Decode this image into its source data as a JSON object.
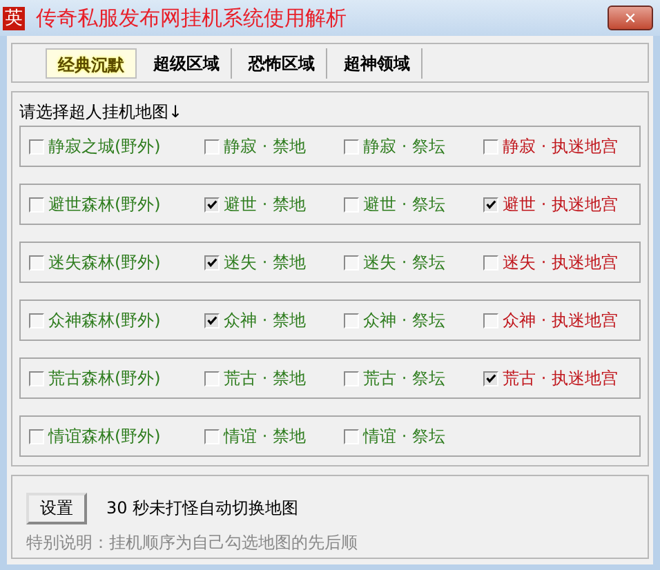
{
  "window": {
    "icon_text": "英",
    "title": "传奇私服发布网挂机系统使用解析",
    "close": "✕"
  },
  "tabs": [
    {
      "label": "经典沉默",
      "selected": true
    },
    {
      "label": "超级区域",
      "selected": false
    },
    {
      "label": "恐怖区域",
      "selected": false
    },
    {
      "label": "超神领域",
      "selected": false
    }
  ],
  "map_heading": "请选择超人挂机地图↓",
  "map_rows": [
    [
      {
        "label": "静寂之城(野外)",
        "checked": false,
        "color": "#2f7d1f"
      },
      {
        "label": "静寂 · 禁地",
        "checked": false,
        "color": "#2f7d1f"
      },
      {
        "label": "静寂 · 祭坛",
        "checked": false,
        "color": "#2f7d1f"
      },
      {
        "label": "静寂 · 执迷地宫",
        "checked": false,
        "color": "#c0161c"
      }
    ],
    [
      {
        "label": "避世森林(野外)",
        "checked": false,
        "color": "#2f7d1f"
      },
      {
        "label": "避世 · 禁地",
        "checked": true,
        "color": "#2f7d1f"
      },
      {
        "label": "避世 · 祭坛",
        "checked": false,
        "color": "#2f7d1f"
      },
      {
        "label": "避世 · 执迷地宫",
        "checked": true,
        "color": "#c0161c"
      }
    ],
    [
      {
        "label": "迷失森林(野外)",
        "checked": false,
        "color": "#2f7d1f"
      },
      {
        "label": "迷失 · 禁地",
        "checked": true,
        "color": "#2f7d1f"
      },
      {
        "label": "迷失 · 祭坛",
        "checked": false,
        "color": "#2f7d1f"
      },
      {
        "label": "迷失 · 执迷地宫",
        "checked": false,
        "color": "#c0161c"
      }
    ],
    [
      {
        "label": "众神森林(野外)",
        "checked": false,
        "color": "#2f7d1f"
      },
      {
        "label": "众神 · 禁地",
        "checked": true,
        "color": "#2f7d1f"
      },
      {
        "label": "众神 · 祭坛",
        "checked": false,
        "color": "#2f7d1f"
      },
      {
        "label": "众神 · 执迷地宫",
        "checked": false,
        "color": "#c0161c"
      }
    ],
    [
      {
        "label": "荒古森林(野外)",
        "checked": false,
        "color": "#2f7d1f"
      },
      {
        "label": "荒古 · 禁地",
        "checked": false,
        "color": "#2f7d1f"
      },
      {
        "label": "荒古 · 祭坛",
        "checked": false,
        "color": "#2f7d1f"
      },
      {
        "label": "荒古 · 执迷地宫",
        "checked": true,
        "color": "#c0161c"
      }
    ],
    [
      {
        "label": "情谊森林(野外)",
        "checked": false,
        "color": "#2f7d1f"
      },
      {
        "label": "情谊 · 禁地",
        "checked": false,
        "color": "#2f7d1f"
      },
      {
        "label": "情谊 · 祭坛",
        "checked": false,
        "color": "#2f7d1f"
      }
    ]
  ],
  "settings_button": "设置",
  "auto_switch_text": "30 秒未打怪自动切换地图",
  "note": "特别说明：挂机顺序为自己勾选地图的先后顺"
}
